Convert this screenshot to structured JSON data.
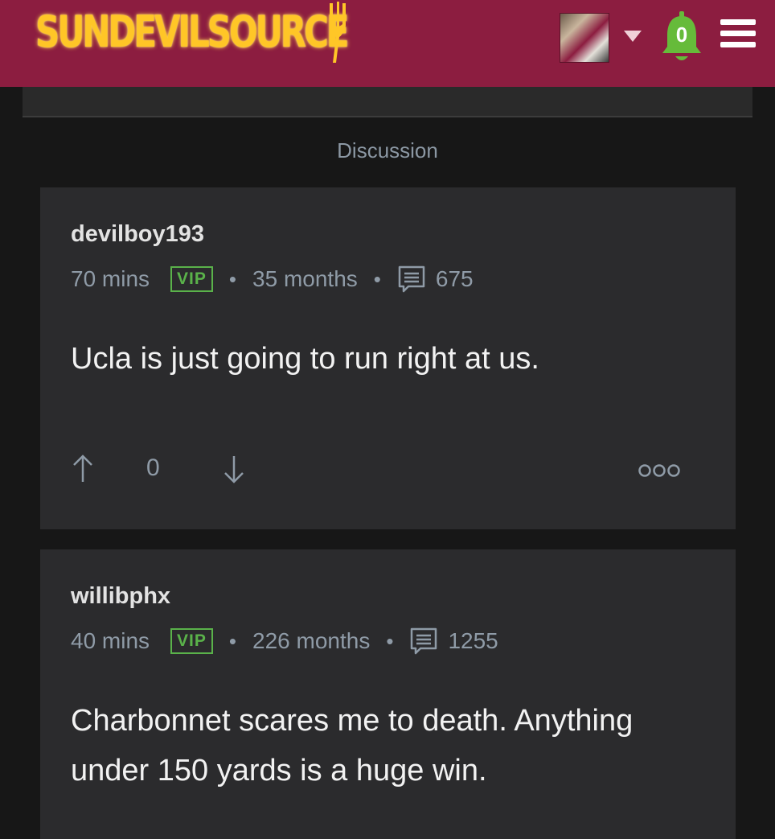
{
  "site": {
    "logo_text": "SUNDEVILSOURCE",
    "brand_color": "#8c1d40",
    "accent_color": "#ffc627",
    "notification_count": "0",
    "icons": [
      "pitchfork-icon",
      "avatar",
      "chevron-down-icon",
      "bell-icon",
      "hamburger-menu-icon"
    ]
  },
  "section": {
    "title": "Discussion"
  },
  "posts": [
    {
      "username": "devilboy193",
      "time": "70 mins",
      "badge": "VIP",
      "tenure": "35 months",
      "post_count": "675",
      "body": "Ucla is just going to run right at us.",
      "votes": "0"
    },
    {
      "username": "willibphx",
      "time": "40 mins",
      "badge": "VIP",
      "tenure": "226 months",
      "post_count": "1255",
      "body": "Charbonnet scares me to death. Anything under 150 yards is a huge win."
    }
  ]
}
